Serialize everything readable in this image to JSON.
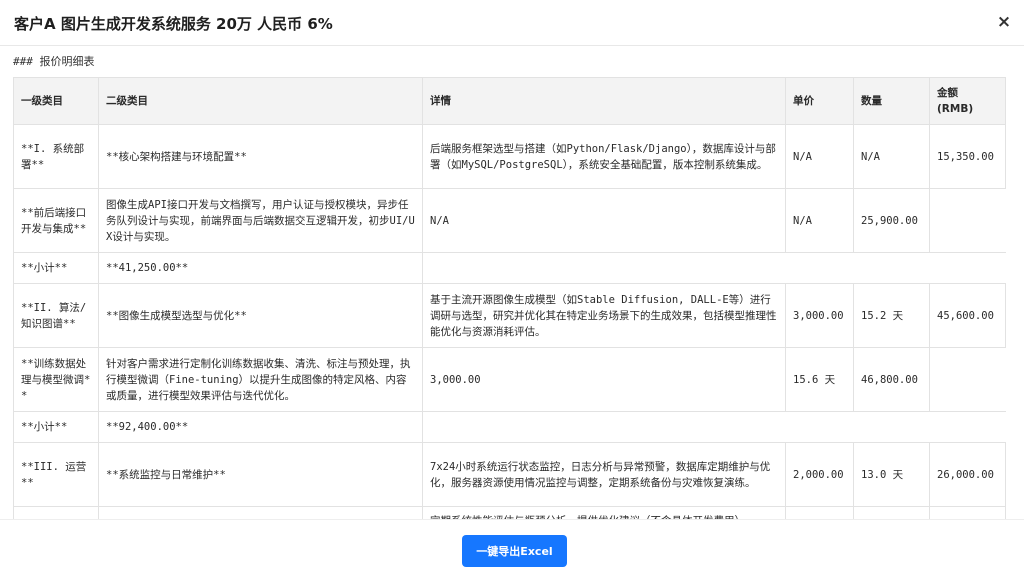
{
  "dialog": {
    "title": "客户A 图片生成开发系统服务 20万 人民币 6%",
    "close_glyph": "×"
  },
  "section": {
    "heading": "### 报价明细表"
  },
  "table": {
    "headers": [
      "一级类目",
      "二级类目",
      "详情",
      "单价",
      "数量",
      "金额\n(RMB)"
    ],
    "rows": [
      [
        "**I. 系统部署**",
        "**核心架构搭建与环境配置**",
        "后端服务框架选型与搭建（如Python/Flask/Django），数据库设计与部署（如MySQL/PostgreSQL），系统安全基础配置，版本控制系统集成。",
        "N/A",
        "N/A",
        "15,350.00"
      ],
      [
        "**前后端接口开发与集成**",
        "图像生成API接口开发与文档撰写，用户认证与授权模块，异步任务队列设计与实现，前端界面与后端数据交互逻辑开发，初步UI/UX设计与实现。",
        "N/A",
        "N/A",
        "25,900.00"
      ],
      [
        "**小计**",
        "**41,250.00**"
      ],
      [
        "**II. 算法/知识图谱**",
        "**图像生成模型选型与优化**",
        "基于主流开源图像生成模型（如Stable Diffusion, DALL-E等）进行调研与选型，研究并优化其在特定业务场景下的生成效果，包括模型推理性能优化与资源消耗评估。",
        "3,000.00",
        "15.2 天",
        "45,600.00"
      ],
      [
        "**训练数据处理与模型微调**",
        "针对客户需求进行定制化训练数据收集、清洗、标注与预处理，执行模型微调（Fine-tuning）以提升生成图像的特定风格、内容或质量，进行模型效果评估与迭代优化。",
        "3,000.00",
        "15.6 天",
        "46,800.00"
      ],
      [
        "**小计**",
        "**92,400.00**"
      ],
      [
        "**III. 运营**",
        "**系统监控与日常维护**",
        "7x24小时系统运行状态监控，日志分析与异常预警，数据库定期维护与优化，服务器资源使用情况监控与调整，定期系统备份与灾难恢复演练。",
        "2,000.00",
        "13.0 天",
        "26,000.00"
      ],
      [
        "",
        "",
        "定期系统性能评估与瓶颈分析，提供优化建议（不含具体开发费用）",
        "",
        "",
        ""
      ]
    ]
  },
  "footer": {
    "export_label": "一键导出Excel"
  }
}
